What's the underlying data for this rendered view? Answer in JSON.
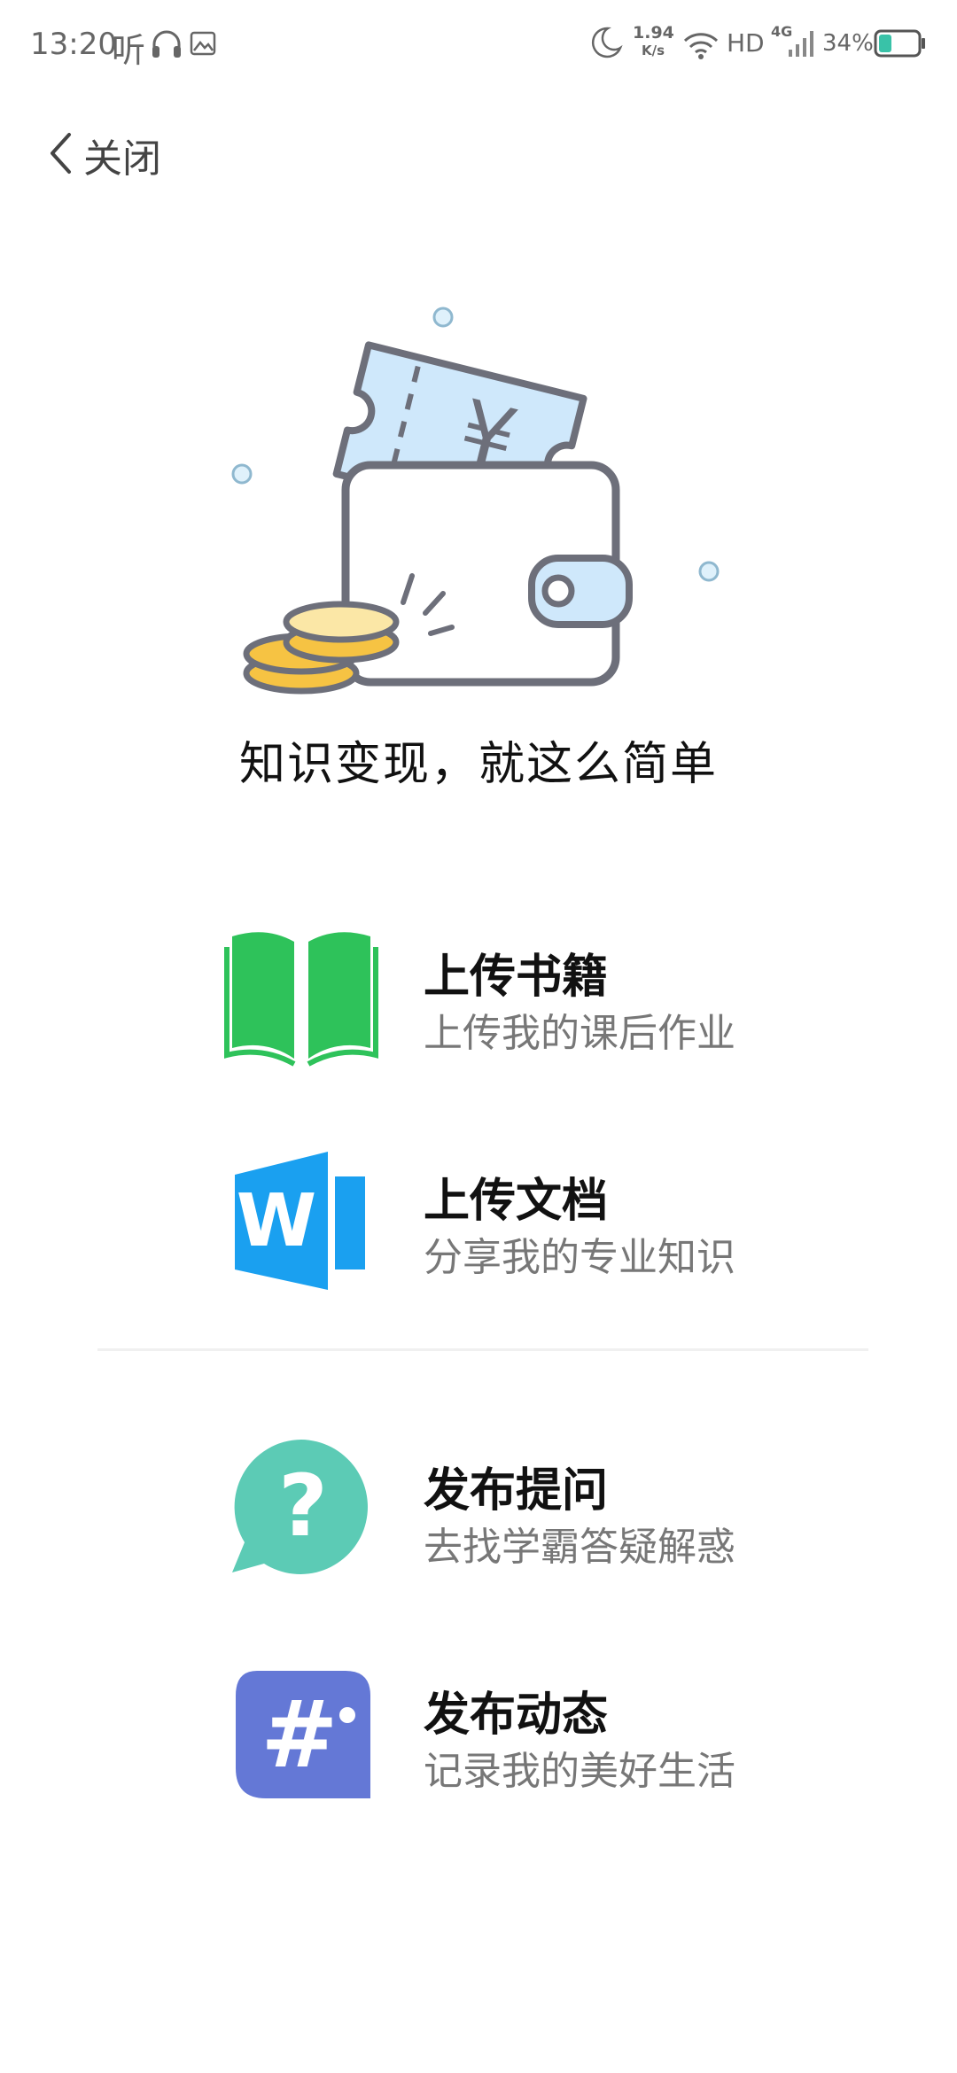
{
  "status_bar": {
    "time": "13:20",
    "app_glyph": "听",
    "net_speed_value": "1.94",
    "net_speed_unit": "K/s",
    "hd_label": "HD",
    "network_label": "4G",
    "battery_percent": "34%",
    "battery_level": 0.34,
    "icons": [
      "headset-icon",
      "gallery-icon",
      "moon-icon",
      "wifi-icon",
      "signal-icon",
      "battery-icon"
    ]
  },
  "header": {
    "close_label": "关闭",
    "back_icon": "chevron-left-icon"
  },
  "hero": {
    "illustration": "wallet-ticket-coins-illustration",
    "title": "知识变现，就这么简单"
  },
  "options": [
    {
      "icon": "open-book-icon",
      "title": "上传书籍",
      "subtitle": "上传我的课后作业",
      "color": "#2ec25a"
    },
    {
      "icon": "word-document-icon",
      "title": "上传文档",
      "subtitle": "分享我的专业知识",
      "color": "#1aa0f0"
    },
    {
      "icon": "question-bubble-icon",
      "title": "发布提问",
      "subtitle": "去找学霸答疑解惑",
      "color": "#5ccbb5"
    },
    {
      "icon": "hashtag-bubble-icon",
      "title": "发布动态",
      "subtitle": "记录我的美好生活",
      "color": "#6478d6"
    }
  ]
}
